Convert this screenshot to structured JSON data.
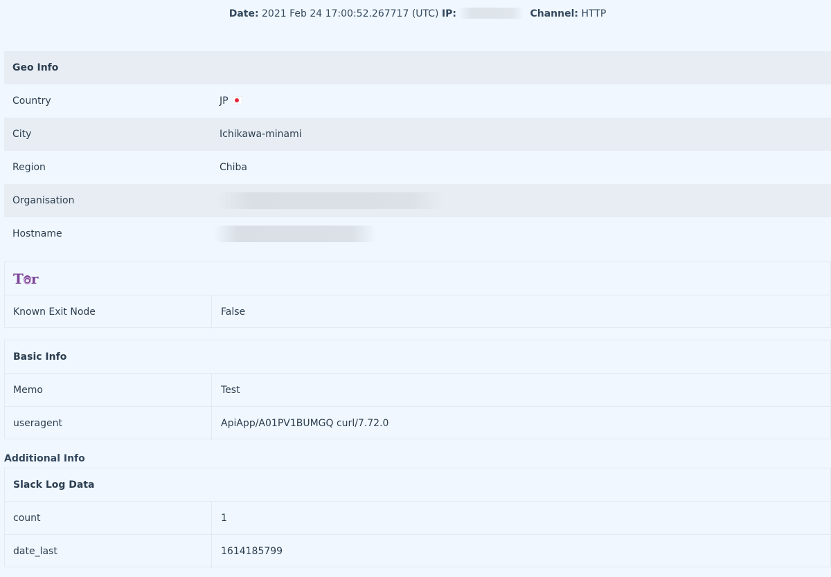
{
  "header": {
    "date_label": "Date:",
    "date_value": "2021 Feb 24 17:00:52.267717 (UTC)",
    "ip_label": "IP:",
    "channel_label": "Channel:",
    "channel_value": "HTTP"
  },
  "geo": {
    "title": "Geo Info",
    "country_label": "Country",
    "country_value": "JP",
    "city_label": "City",
    "city_value": "Ichikawa-minami",
    "region_label": "Region",
    "region_value": "Chiba",
    "organisation_label": "Organisation",
    "hostname_label": "Hostname"
  },
  "tor": {
    "logo_text_left": "T",
    "logo_text_right": "r",
    "known_exit_node_label": "Known Exit Node",
    "known_exit_node_value": "False"
  },
  "basic": {
    "title": "Basic Info",
    "memo_label": "Memo",
    "memo_value": "Test",
    "useragent_label": "useragent",
    "useragent_value": "ApiApp/A01PV1BUMGQ curl/7.72.0"
  },
  "additional": {
    "title": "Additional Info",
    "slack_title": "Slack Log Data",
    "count_label": "count",
    "count_value": "1",
    "date_last_label": "date_last",
    "date_last_value": "1614185799"
  },
  "icons": {
    "flag": "japan-flag-icon",
    "tor": "tor-logo-icon"
  }
}
